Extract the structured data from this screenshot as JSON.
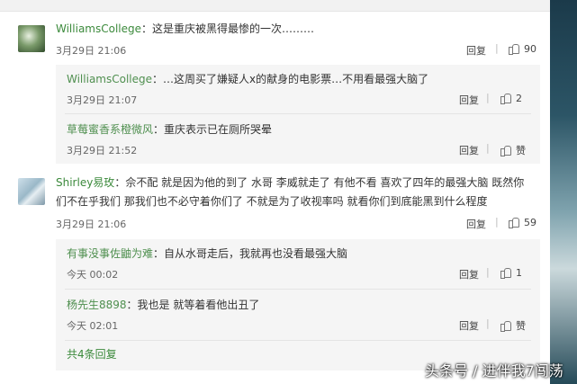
{
  "comments": [
    {
      "user": "WilliamsCollege",
      "text": "：这是重庆被黑得最惨的一次………",
      "time": "3月29日 21:06",
      "reply_label": "回复",
      "likes": "90",
      "replies": [
        {
          "user": "WilliamsCollege",
          "text": "：…这周买了嫌疑人x的献身的电影票…不用看最强大脑了",
          "time": "3月29日 21:07",
          "reply_label": "回复",
          "likes": "2"
        },
        {
          "user": "草莓蜜香系橙微风",
          "text": "：重庆表示已在厕所哭晕",
          "time": "3月29日 21:52",
          "reply_label": "回复",
          "likes": "赞"
        }
      ]
    },
    {
      "user": "Shirley易玫",
      "text_line1": "：佘不配 就是因为他的到了 水哥 李威就走了 有他不看 喜欢了四年的最强大脑 既然你",
      "text_line2": "们不在乎我们 那我们也不必守着你们了 不就是为了收视率吗 就看你们到底能黑到什么程度",
      "time": "3月29日 21:06",
      "reply_label": "回复",
      "likes": "59",
      "replies": [
        {
          "user": "有事没事佐鼬为难",
          "text": "：自从水哥走后，我就再也没看最强大脑",
          "time": "今天 00:02",
          "reply_label": "回复",
          "likes": "1"
        },
        {
          "user": "杨先生8898",
          "text": "：我也是 就等着看他出丑了",
          "time": "今天 02:01",
          "reply_label": "回复",
          "likes": "赞"
        }
      ],
      "more_label": "共4条回复"
    }
  ],
  "watermark": "头条号 / 进伴我7闯荡"
}
